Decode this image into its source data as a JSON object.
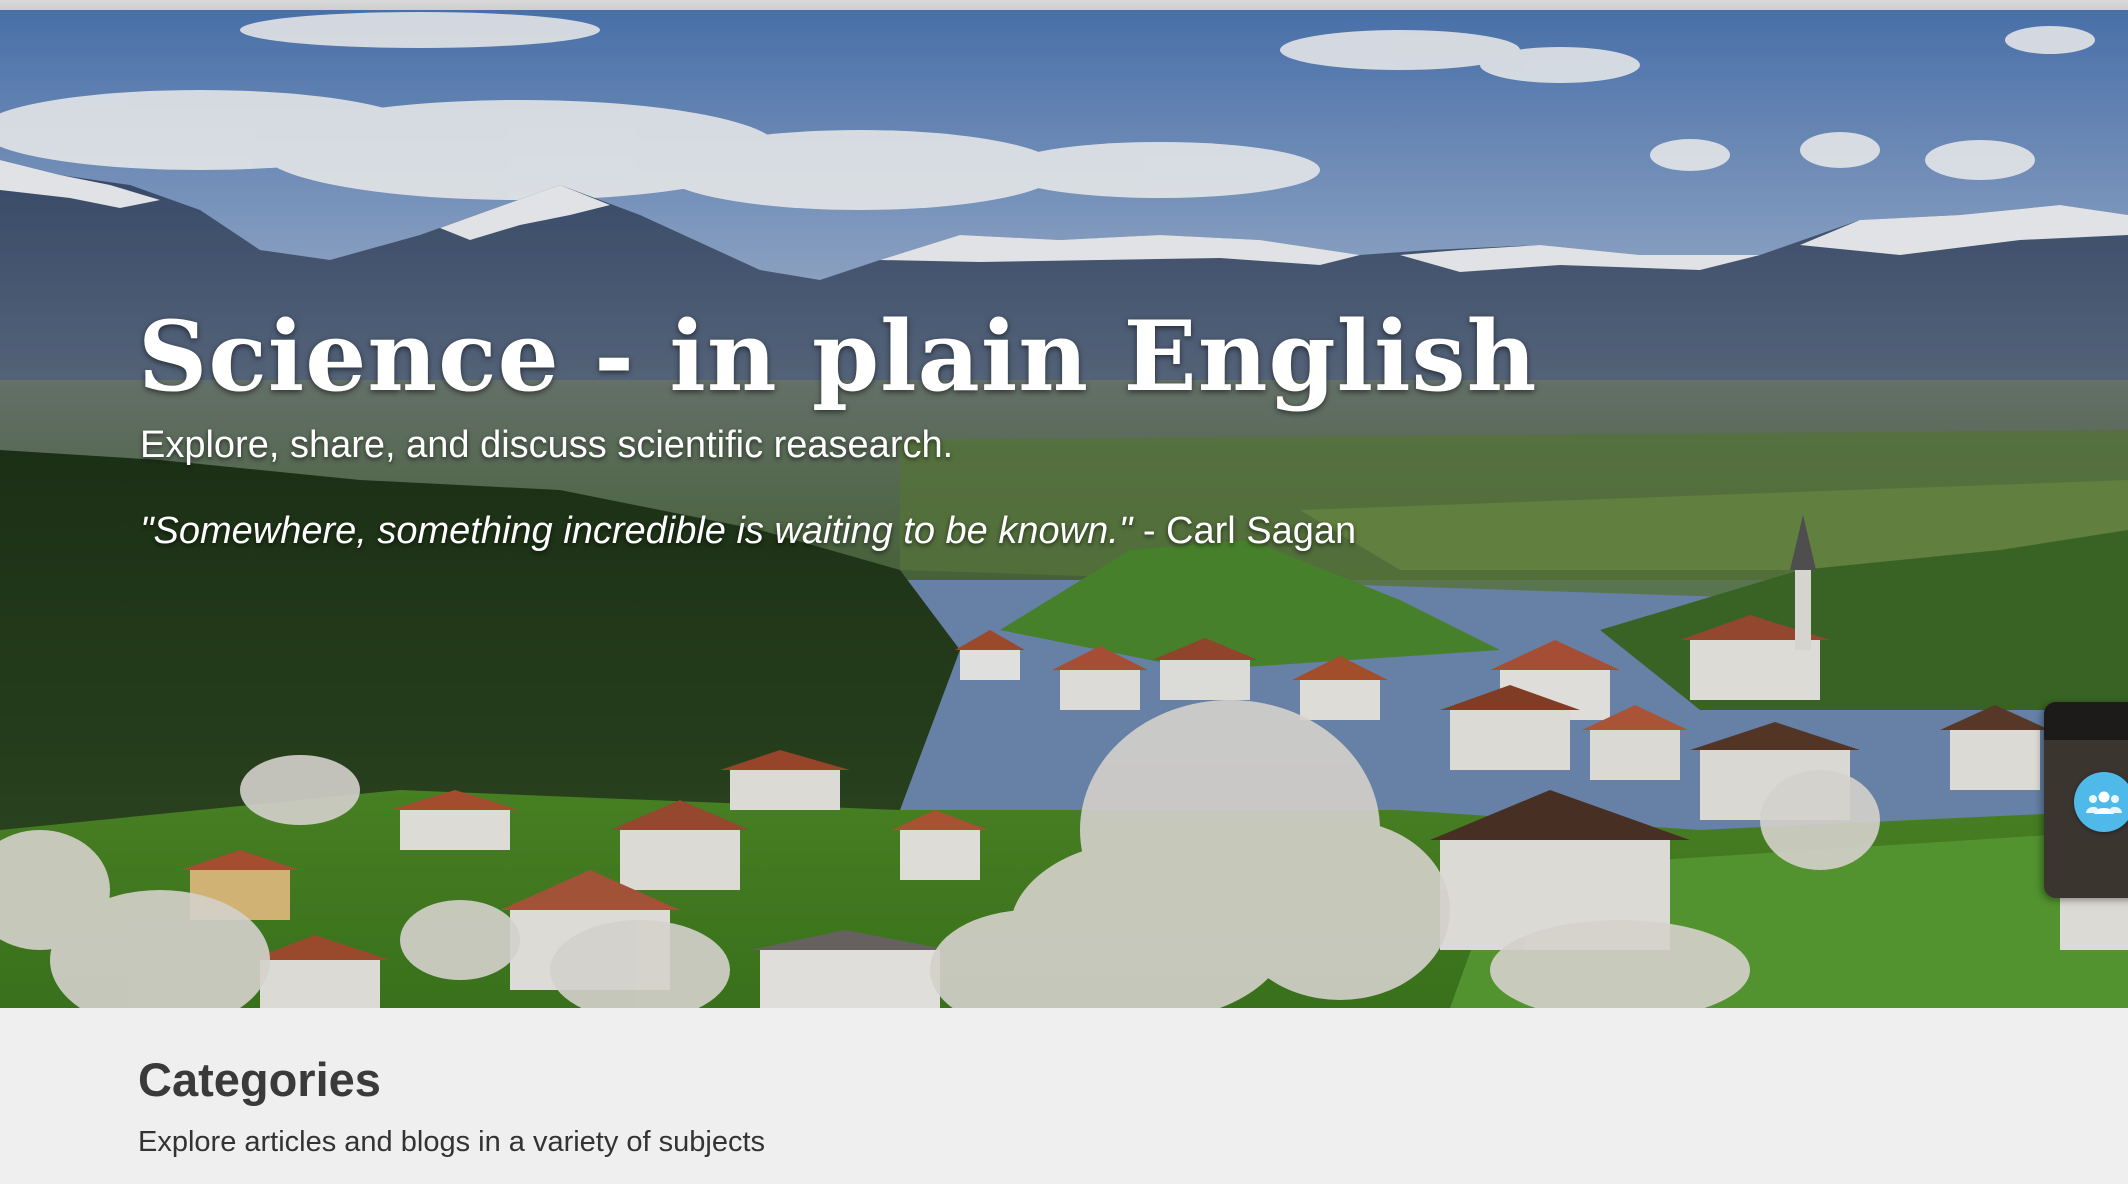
{
  "hero": {
    "title": "Science - in plain English",
    "subtitle": "Explore, share, and discuss scientific reasearch.",
    "quote_text": "\"Somewhere, something incredible is waiting to be known.\"",
    "quote_author": " - Carl Sagan",
    "background_image": "alpine-village-landscape"
  },
  "categories": {
    "heading": "Categories",
    "description": "Explore articles and blogs in a variety of subjects"
  },
  "chat_widget": {
    "icon": "group-chat-icon",
    "color": "#4fb9ea"
  }
}
